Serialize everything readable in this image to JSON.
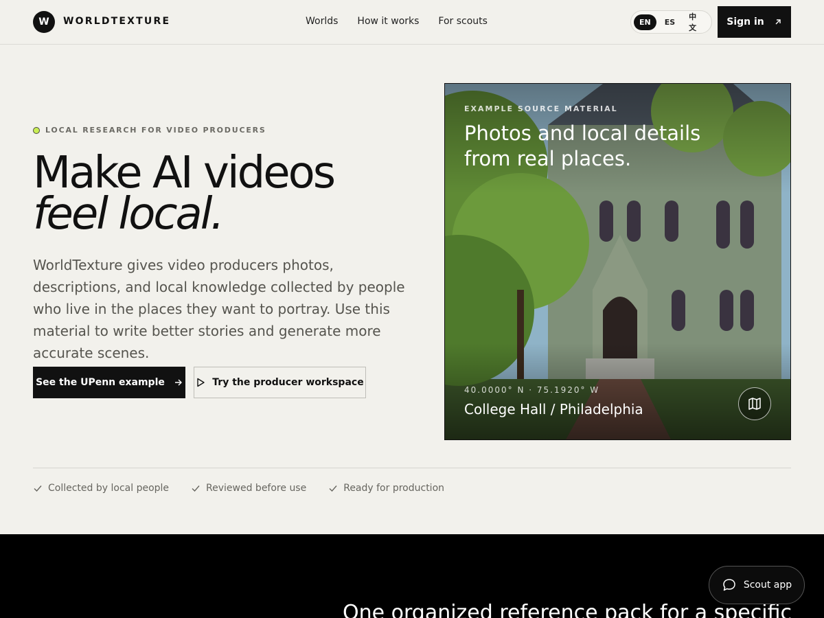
{
  "brand": {
    "mark": "W",
    "name": "WORLDTEXTURE"
  },
  "nav": {
    "items": [
      "Worlds",
      "How it works",
      "For scouts"
    ]
  },
  "languages": {
    "items": [
      "EN",
      "ES",
      "中文"
    ],
    "active": "EN"
  },
  "header": {
    "signin_label": "Sign in",
    "signin_icon": "arrow-up-right-icon"
  },
  "hero": {
    "eyebrow": "LOCAL RESEARCH FOR VIDEO PRODUCERS",
    "eyebrow_dot_color": "#c9ee54",
    "title_line1": "Make AI videos",
    "title_line2": "feel local.",
    "lede": "WorldTexture gives video producers photos, descriptions, and local knowledge collected by people who live in the places they want to portray. Use this material to write better stories and generate more accurate scenes.",
    "primary_cta": "See the UPenn example",
    "secondary_cta": "Try the producer workspace"
  },
  "card": {
    "eyebrow": "EXAMPLE SOURCE MATERIAL",
    "title": "Photos and local details from real places.",
    "coords": "40.0000° N · 75.1920° W",
    "place": "College Hall / Philadelphia",
    "map_icon": "map-icon"
  },
  "trust": [
    "Collected by local people",
    "Reviewed before use",
    "Ready for production"
  ],
  "section2": {
    "heading": "One organized reference pack for a specific"
  },
  "scout": {
    "label": "Scout app",
    "icon": "chat-bubble-icon"
  }
}
